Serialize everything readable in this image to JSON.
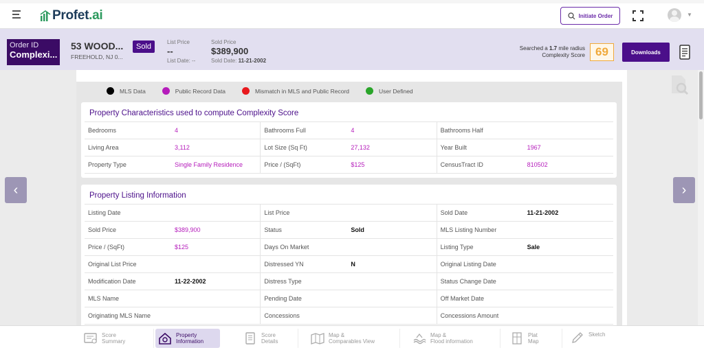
{
  "app": {
    "logo_text": "Profet",
    "logo_suffix": ".ai",
    "initiate_label": "Initiate Order"
  },
  "order": {
    "id_label": "Order ID",
    "id_value": "Complexi...",
    "address_line1": "53 WOOD...",
    "address_line2": "FREEHOLD, NJ 0...",
    "status_badge": "Sold",
    "list_price_label": "List Price",
    "list_price_value": "--",
    "list_date": "List Date: --",
    "sold_price_label": "Sold Price",
    "sold_price_value": "$389,900",
    "sold_date_label": "Sold Date:",
    "sold_date_value": "11-21-2002",
    "search_note_pre": "Searched a",
    "search_radius": "1.7",
    "search_note_post": "mile radius",
    "complexity_label": "Complexity Score",
    "complexity_score": "69",
    "downloads_label": "Downloads"
  },
  "legend": [
    {
      "label": "MLS Data",
      "color": "#000000"
    },
    {
      "label": "Public Record Data",
      "color": "#b51cbb"
    },
    {
      "label": "Mismatch in MLS and Public Record",
      "color": "#e8191d"
    },
    {
      "label": "User Defined",
      "color": "#2aa52a"
    }
  ],
  "characteristics": {
    "title": "Property Characteristics used to compute Complexity Score",
    "rows": [
      [
        {
          "k": "Bedrooms",
          "v": "4",
          "src": "pr"
        },
        {
          "k": "Bathrooms Full",
          "v": "4",
          "src": "pr"
        },
        {
          "k": "Bathrooms Half",
          "v": "",
          "src": "pr"
        }
      ],
      [
        {
          "k": "Living Area",
          "v": "3,112",
          "src": "pr"
        },
        {
          "k": "Lot Size (Sq Ft)",
          "v": "27,132",
          "src": "pr"
        },
        {
          "k": "Year Built",
          "v": "1967",
          "src": "pr"
        }
      ],
      [
        {
          "k": "Property Type",
          "v": "Single Family Residence",
          "src": "pr"
        },
        {
          "k": "Price / (SqFt)",
          "v": "$125",
          "src": "pr"
        },
        {
          "k": "CensusTract ID",
          "v": "810502",
          "src": "pr"
        }
      ]
    ]
  },
  "listing": {
    "title": "Property Listing Information",
    "rows": [
      [
        {
          "k": "Listing Date",
          "v": "",
          "src": "pr"
        },
        {
          "k": "List Price",
          "v": "",
          "src": "pr"
        },
        {
          "k": "Sold Date",
          "v": "11-21-2002",
          "src": "mls"
        }
      ],
      [
        {
          "k": "Sold Price",
          "v": "$389,900",
          "src": "pr"
        },
        {
          "k": "Status",
          "v": "Sold",
          "src": "mls"
        },
        {
          "k": "MLS Listing Number",
          "v": "",
          "src": "pr"
        }
      ],
      [
        {
          "k": "Price / (SqFt)",
          "v": "$125",
          "src": "pr"
        },
        {
          "k": "Days On Market",
          "v": "",
          "src": "pr"
        },
        {
          "k": "Listing Type",
          "v": "Sale",
          "src": "mls"
        }
      ],
      [
        {
          "k": "Original List Price",
          "v": "",
          "src": "pr"
        },
        {
          "k": "Distressed YN",
          "v": "N",
          "src": "mls"
        },
        {
          "k": "Original Listing Date",
          "v": "",
          "src": "pr"
        }
      ],
      [
        {
          "k": "Modification Date",
          "v": "11-22-2002",
          "src": "mls"
        },
        {
          "k": "Distress Type",
          "v": "",
          "src": "pr"
        },
        {
          "k": "Status Change Date",
          "v": "",
          "src": "pr"
        }
      ],
      [
        {
          "k": "MLS Name",
          "v": "",
          "src": "pr"
        },
        {
          "k": "Pending Date",
          "v": "",
          "src": "pr"
        },
        {
          "k": "Off Market Date",
          "v": "",
          "src": "pr"
        }
      ],
      [
        {
          "k": "Originating MLS Name",
          "v": "",
          "src": "pr"
        },
        {
          "k": "Concessions",
          "v": "",
          "src": "pr"
        },
        {
          "k": "Concessions Amount",
          "v": "",
          "src": "pr"
        }
      ]
    ]
  },
  "bottom_tabs": [
    {
      "line1": "Score",
      "line2": "Summary",
      "icon": "score-summary-icon",
      "active": false
    },
    {
      "line1": "Property",
      "line2": "Information",
      "icon": "house-icon",
      "active": true
    },
    {
      "line1": "Score",
      "line2": "Details",
      "icon": "score-details-icon",
      "active": false
    },
    {
      "line1": "Map &",
      "line2": "Comparables View",
      "icon": "map-icon",
      "active": false
    },
    {
      "line1": "Map &",
      "line2": "Flood information",
      "icon": "flood-map-icon",
      "active": false
    },
    {
      "line1": "Plat",
      "line2": "Map",
      "icon": "plat-map-icon",
      "active": false
    },
    {
      "line1": "Sketch",
      "line2": "",
      "icon": "sketch-icon",
      "active": false
    }
  ]
}
